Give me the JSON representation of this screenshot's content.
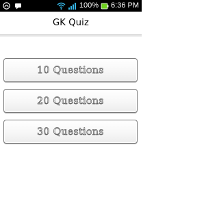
{
  "status_bar": {
    "battery_percent": "100%",
    "time": "6:36 PM",
    "icons": [
      "notification-icon",
      "message-icon",
      "wifi-icon",
      "signal-icon",
      "battery-icon"
    ]
  },
  "app": {
    "title": "GK Quiz"
  },
  "menu": {
    "items": [
      {
        "label": "10 Questions"
      },
      {
        "label": "20 Questions"
      },
      {
        "label": "30 Questions"
      }
    ]
  },
  "colors": {
    "status_bar_bg": "#000000",
    "background": "#ffffff",
    "button_border": "#7a7a7a",
    "label_outline": "#5e5e5e",
    "battery_green": "#6ed11f"
  }
}
